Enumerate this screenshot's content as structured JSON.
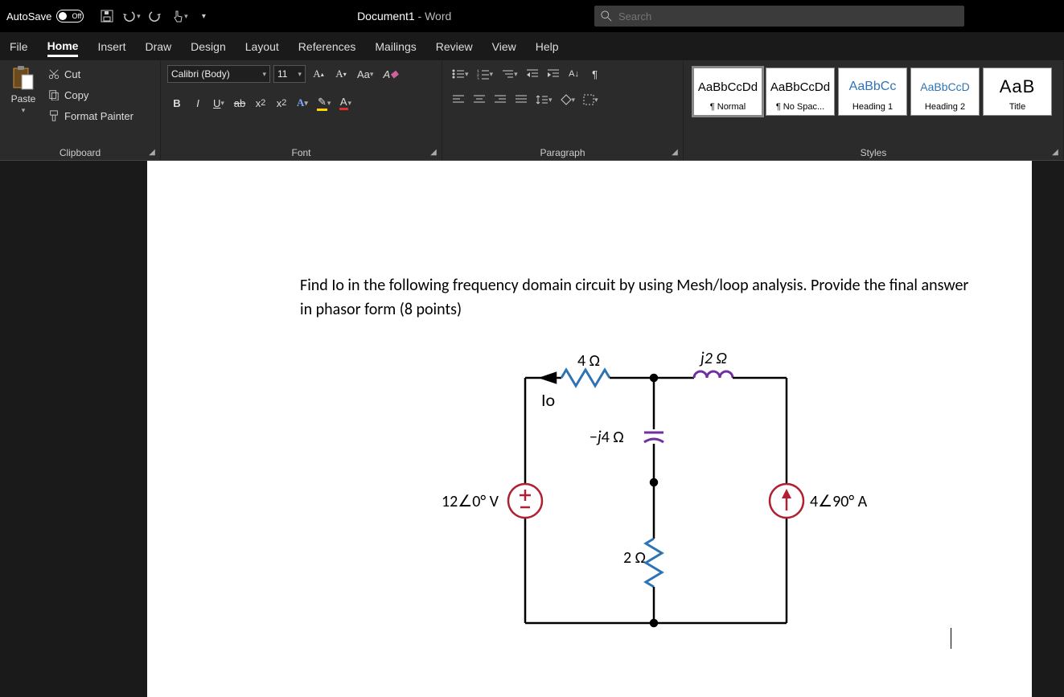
{
  "titlebar": {
    "autosave_label": "AutoSave",
    "autosave_state": "Off",
    "doc_title": "Document1",
    "app_suffix": " - Word",
    "search_placeholder": "Search"
  },
  "tabs": {
    "file": "File",
    "home": "Home",
    "insert": "Insert",
    "draw": "Draw",
    "design": "Design",
    "layout": "Layout",
    "references": "References",
    "mailings": "Mailings",
    "review": "Review",
    "view": "View",
    "help": "Help"
  },
  "clipboard": {
    "paste": "Paste",
    "cut": "Cut",
    "copy": "Copy",
    "format_painter": "Format Painter",
    "group_label": "Clipboard"
  },
  "font": {
    "font_name": "Calibri (Body)",
    "font_size": "11",
    "group_label": "Font"
  },
  "paragraph": {
    "group_label": "Paragraph"
  },
  "styles": {
    "items": [
      {
        "sample": "AaBbCcDd",
        "name": "¶ Normal",
        "class": ""
      },
      {
        "sample": "AaBbCcDd",
        "name": "¶ No Spac...",
        "class": ""
      },
      {
        "sample": "AaBbCc",
        "name": "Heading 1",
        "class": "heading1"
      },
      {
        "sample": "AaBbCcD",
        "name": "Heading 2",
        "class": "heading2"
      },
      {
        "sample": "AaB",
        "name": "Title",
        "class": "titlestyle"
      }
    ],
    "group_label": "Styles"
  },
  "document": {
    "problem": "Find Io in the following frequency domain circuit by using Mesh/loop analysis. Provide the final answer in phasor form (8 points)",
    "circuit": {
      "r_top": "4 Ω",
      "l_top": "j2 Ω",
      "io_label": "Io",
      "c_mid": "−j4 Ω",
      "v_src": "12∠0° V",
      "r_mid": "2 Ω",
      "i_src": "4∠90° A"
    }
  }
}
